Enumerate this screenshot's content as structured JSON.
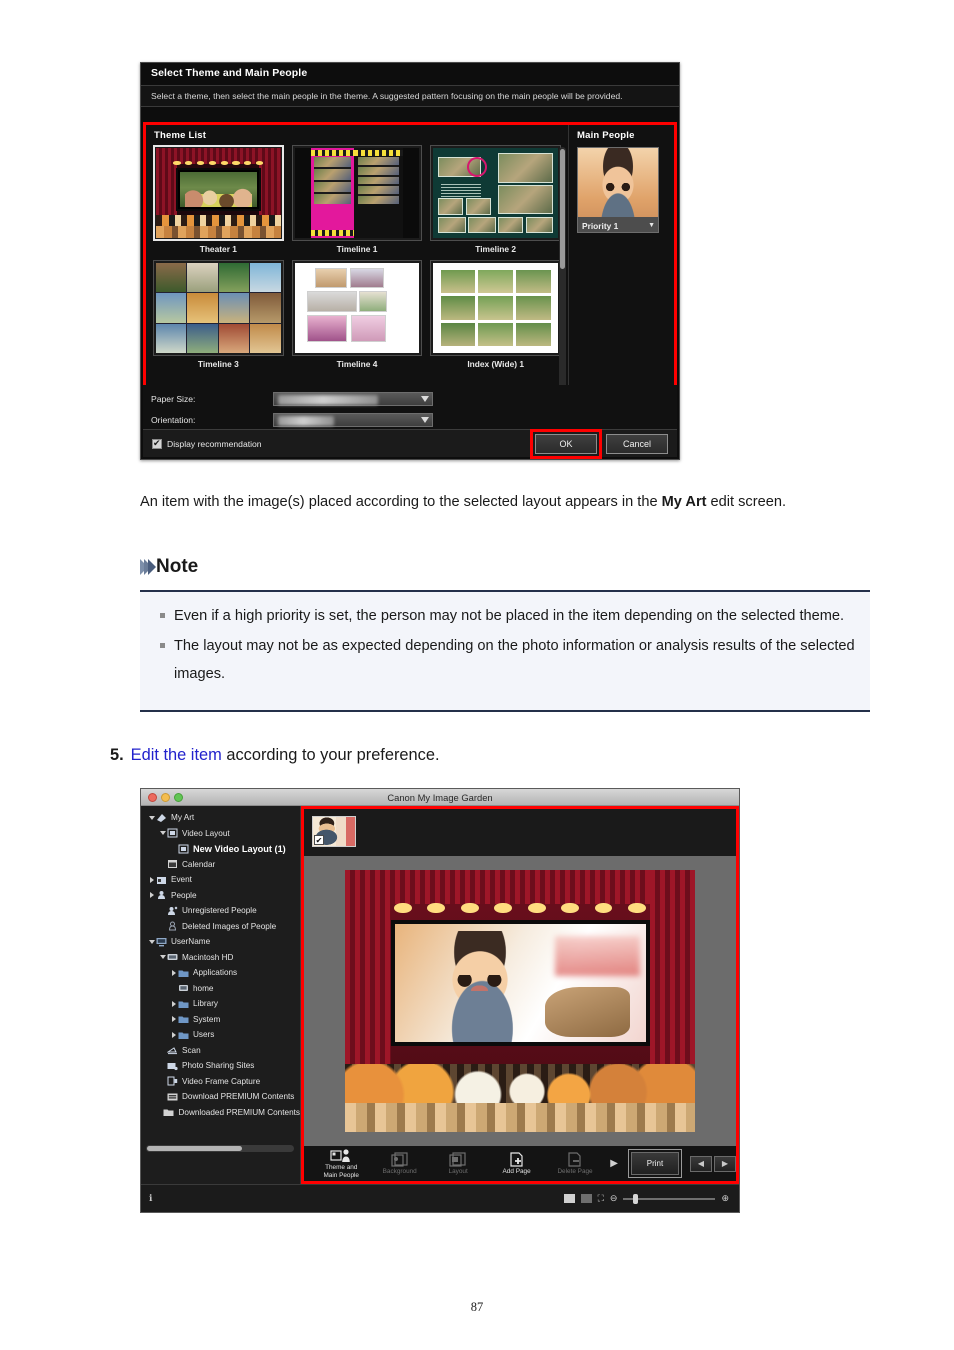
{
  "dialog": {
    "title": "Select Theme and Main People",
    "subtitle": "Select a theme, then select the main people in the theme. A suggested pattern focusing on the main people will be provided.",
    "theme_list_label": "Theme List",
    "main_people_label": "Main People",
    "themes": [
      {
        "label": "Theater 1",
        "selected": true
      },
      {
        "label": "Timeline 1",
        "selected": false
      },
      {
        "label": "Timeline 2",
        "selected": false
      },
      {
        "label": "Timeline 3",
        "selected": false
      },
      {
        "label": "Timeline 4",
        "selected": false
      },
      {
        "label": "Index (Wide) 1",
        "selected": false
      }
    ],
    "person": {
      "priority_label": "Priority 1"
    },
    "options": [
      {
        "label": "Paper Size:",
        "value": ""
      },
      {
        "label": "Orientation:",
        "value": ""
      }
    ],
    "checkbox_label": "Display recommendation",
    "ok_label": "OK",
    "cancel_label": "Cancel",
    "highlight_color": "#ff0000"
  },
  "body": {
    "paragraph_1": "An item with the image(s) placed according to the selected layout appears in the ",
    "paragraph_1_bold": "My Art",
    "paragraph_1_tail": " edit screen.",
    "note_title": "Note",
    "notes": [
      "Even if a high priority is set, the person may not be placed in the item depending on the selected theme.",
      "The layout may not be as expected depending on the photo information or analysis results of the selected images."
    ],
    "step": {
      "number": "5.",
      "link": "Edit the item",
      "rest": " according to your preference."
    }
  },
  "app_window": {
    "title": "Canon My Image Garden",
    "sidebar": [
      {
        "label": "My Art",
        "indent": 0,
        "twisty": "down",
        "icon": "art-icon",
        "selected": false
      },
      {
        "label": "Video Layout",
        "indent": 1,
        "twisty": "down",
        "icon": "video-layout-icon",
        "selected": false
      },
      {
        "label": "New Video Layout (1)",
        "indent": 2,
        "twisty": "none",
        "icon": "video-layout-icon",
        "selected": true
      },
      {
        "label": "Calendar",
        "indent": 1,
        "twisty": "none",
        "icon": "calendar-icon",
        "selected": false
      },
      {
        "label": "Event",
        "indent": 0,
        "twisty": "right",
        "icon": "event-icon",
        "selected": false
      },
      {
        "label": "People",
        "indent": 0,
        "twisty": "right",
        "icon": "people-icon",
        "selected": false
      },
      {
        "label": "Unregistered People",
        "indent": 1,
        "twisty": "none",
        "icon": "unregistered-people-icon",
        "selected": false
      },
      {
        "label": "Deleted Images of People",
        "indent": 1,
        "twisty": "none",
        "icon": "deleted-people-icon",
        "selected": false
      },
      {
        "label": "UserName",
        "indent": 0,
        "twisty": "down",
        "icon": "computer-icon",
        "selected": false
      },
      {
        "label": "Macintosh HD",
        "indent": 1,
        "twisty": "down",
        "icon": "disk-icon",
        "selected": false
      },
      {
        "label": "Applications",
        "indent": 2,
        "twisty": "right",
        "icon": "folder-icon",
        "selected": false
      },
      {
        "label": "home",
        "indent": 2,
        "twisty": "none",
        "icon": "home-icon",
        "selected": false
      },
      {
        "label": "Library",
        "indent": 2,
        "twisty": "right",
        "icon": "folder-icon",
        "selected": false
      },
      {
        "label": "System",
        "indent": 2,
        "twisty": "right",
        "icon": "folder-icon",
        "selected": false
      },
      {
        "label": "Users",
        "indent": 2,
        "twisty": "right",
        "icon": "folder-icon",
        "selected": false
      },
      {
        "label": "Scan",
        "indent": 1,
        "twisty": "none",
        "icon": "scan-icon",
        "selected": false
      },
      {
        "label": "Photo Sharing Sites",
        "indent": 1,
        "twisty": "none",
        "icon": "photo-sharing-icon",
        "selected": false
      },
      {
        "label": "Video Frame Capture",
        "indent": 1,
        "twisty": "none",
        "icon": "video-frame-icon",
        "selected": false
      },
      {
        "label": "Download PREMIUM Contents",
        "indent": 1,
        "twisty": "none",
        "icon": "download-premium-icon",
        "selected": false
      },
      {
        "label": "Downloaded PREMIUM Contents",
        "indent": 1,
        "twisty": "none",
        "icon": "downloaded-premium-icon",
        "selected": false
      }
    ],
    "toolbar": [
      {
        "label_line1": "Theme and",
        "label_line2": "Main People",
        "icon": "theme-people-icon",
        "enabled": true
      },
      {
        "label_line1": "Background",
        "label_line2": "",
        "icon": "background-icon",
        "enabled": false
      },
      {
        "label_line1": "Layout",
        "label_line2": "",
        "icon": "layout-icon",
        "enabled": false
      },
      {
        "label_line1": "Add Page",
        "label_line2": "",
        "icon": "add-page-icon",
        "enabled": true
      },
      {
        "label_line1": "Delete Page",
        "label_line2": "",
        "icon": "delete-page-icon",
        "enabled": false
      }
    ],
    "print_label": "Print",
    "next_arrow": "▶",
    "nav_prev": "◀",
    "nav_next": "▶"
  },
  "page_number": "87"
}
